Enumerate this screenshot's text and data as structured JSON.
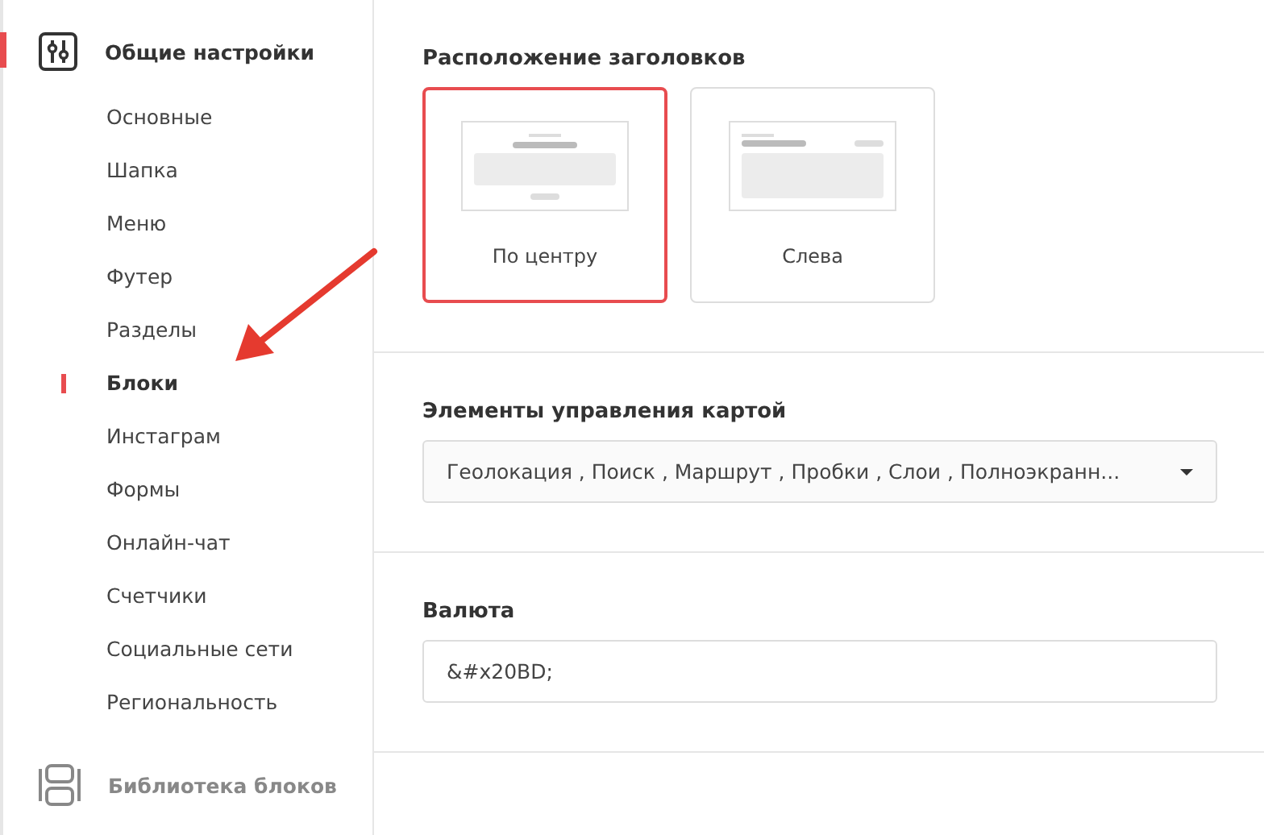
{
  "sidebar": {
    "groups": [
      {
        "title": "Общие настройки",
        "kind": "settings",
        "selected": true,
        "items": [
          {
            "label": "Основные",
            "selected": false
          },
          {
            "label": "Шапка",
            "selected": false
          },
          {
            "label": "Меню",
            "selected": false
          },
          {
            "label": "Футер",
            "selected": false
          },
          {
            "label": "Разделы",
            "selected": false
          },
          {
            "label": "Блоки",
            "selected": true
          },
          {
            "label": "Инстаграм",
            "selected": false
          },
          {
            "label": "Формы",
            "selected": false
          },
          {
            "label": "Онлайн-чат",
            "selected": false
          },
          {
            "label": "Счетчики",
            "selected": false
          },
          {
            "label": "Социальные сети",
            "selected": false
          },
          {
            "label": "Региональность",
            "selected": false
          }
        ]
      },
      {
        "title": "Библиотека блоков",
        "kind": "library",
        "selected": false
      }
    ]
  },
  "sections": [
    {
      "kind": "cards",
      "title": "Расположение заголовков",
      "options": [
        {
          "label": "По центру",
          "kind": "center",
          "selected": true
        },
        {
          "label": "Слева",
          "kind": "left",
          "selected": false
        }
      ]
    },
    {
      "kind": "select",
      "title": "Элементы управления картой",
      "value": "Геолокация , Поиск , Маршрут , Пробки , Слои , Полноэкранн..."
    },
    {
      "kind": "input",
      "title": "Валюта",
      "value": "&#x20BD;"
    }
  ],
  "annotation": {
    "kind": "arrow"
  }
}
